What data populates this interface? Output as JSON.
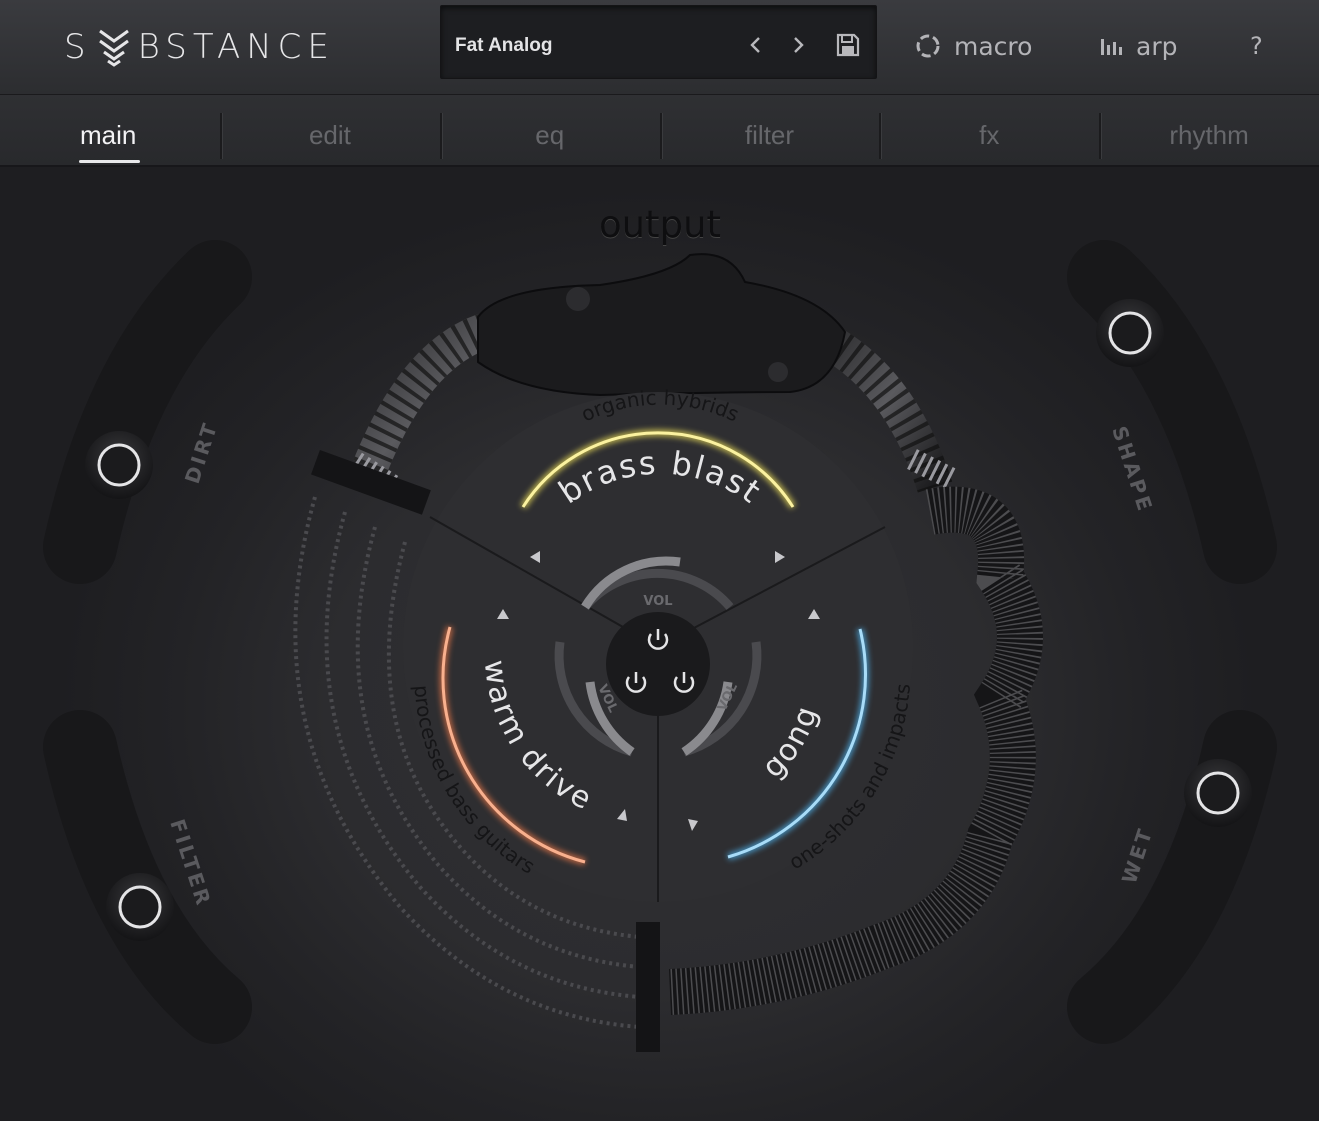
{
  "header": {
    "logo": "SUBSTANCE",
    "preset_name": "Fat Analog",
    "macro_label": "macro",
    "arp_label": "arp",
    "help_label": "?"
  },
  "tabs": [
    {
      "label": "main",
      "active": true
    },
    {
      "label": "edit",
      "active": false
    },
    {
      "label": "eq",
      "active": false
    },
    {
      "label": "filter",
      "active": false
    },
    {
      "label": "fx",
      "active": false
    },
    {
      "label": "rhythm",
      "active": false
    }
  ],
  "main": {
    "output_label": "output",
    "macros": {
      "dirt": "DIRT",
      "filter": "FILTER",
      "shape": "SHAPE",
      "wet": "WET"
    },
    "layers": {
      "top": {
        "category": "organic hybrids",
        "name": "brass blast",
        "vol_label": "VOL",
        "color": "#f2e35a"
      },
      "left": {
        "category": "processed bass guitars",
        "name": "warm drive",
        "vol_label": "VOL",
        "color": "#f07a4a"
      },
      "right": {
        "category": "one-shots and impacts",
        "name": "gong",
        "vol_label": "VOL",
        "color": "#4fb6f2"
      }
    }
  },
  "colors": {
    "background": "#1f1f22",
    "accent_yellow": "#f2e35a",
    "accent_orange": "#f07a4a",
    "accent_blue": "#4fb6f2"
  }
}
